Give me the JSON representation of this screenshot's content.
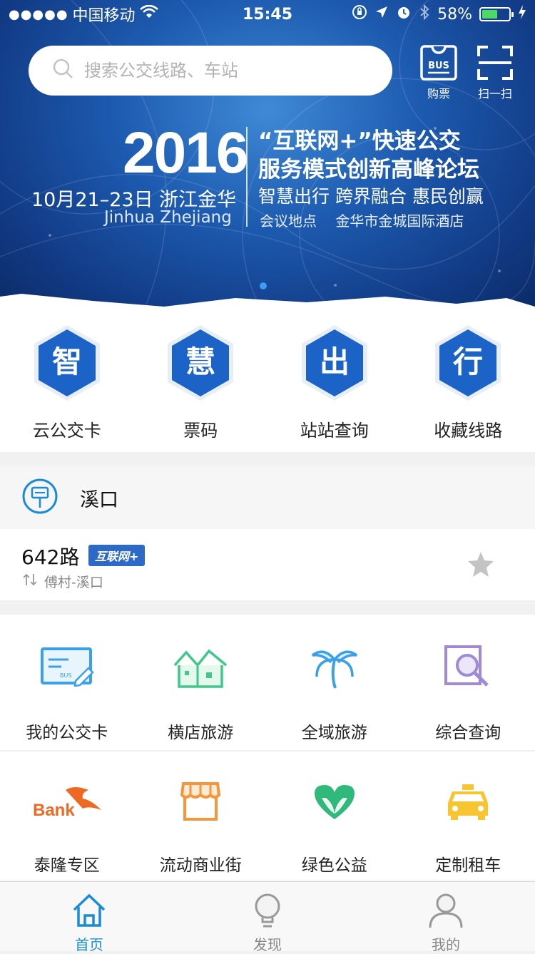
{
  "status_bar": {
    "signal": "●●●●●",
    "carrier": "中国移动",
    "time": "15:45",
    "battery_pct": "58%",
    "battery_level": 0.58
  },
  "search": {
    "placeholder": "搜索公交线路、车站"
  },
  "top_actions": [
    {
      "label": "购票",
      "icon": "bus-ticket-icon",
      "icon_text": "BUS"
    },
    {
      "label": "扫一扫",
      "icon": "scan-icon"
    }
  ],
  "banner": {
    "year": "2016",
    "date_place": "10月21–23日 浙江金华",
    "english": "Jinhua Zhejiang",
    "title_line1": "“互联网+”快速公交",
    "title_line2": "服务模式创新高峰论坛",
    "slogan": "智慧出行 跨界融合 惠民创赢",
    "venue": "会议地点 金华市金城国际酒店"
  },
  "quick_actions": [
    {
      "char": "智",
      "label": "云公交卡"
    },
    {
      "char": "慧",
      "label": "票码"
    },
    {
      "char": "出",
      "label": "站站查询"
    },
    {
      "char": "行",
      "label": "收藏线路"
    }
  ],
  "stop": {
    "name": "溪口",
    "route": {
      "number": "642路",
      "tag": "互联网+",
      "direction": "傅村-溪口"
    }
  },
  "services": [
    [
      {
        "label": "我的公交卡",
        "icon": "bus-card-icon",
        "icon_text": "BUS"
      },
      {
        "label": "横店旅游",
        "icon": "houses-icon"
      },
      {
        "label": "全域旅游",
        "icon": "palm-tree-icon"
      },
      {
        "label": "综合查询",
        "icon": "magnifier-document-icon"
      }
    ],
    [
      {
        "label": "泰隆专区",
        "icon": "bank-logo-icon",
        "icon_text": "Bank"
      },
      {
        "label": "流动商业街",
        "icon": "shop-icon"
      },
      {
        "label": "绿色公益",
        "icon": "green-heart-icon"
      },
      {
        "label": "定制租车",
        "icon": "taxi-icon"
      }
    ]
  ],
  "tabs": [
    {
      "label": "首页",
      "icon": "home-icon",
      "active": true
    },
    {
      "label": "发现",
      "icon": "lightbulb-icon",
      "active": false
    },
    {
      "label": "我的",
      "icon": "user-icon",
      "active": false
    }
  ],
  "colors": {
    "accent": "#1b8bd8",
    "banner_blue": "#1d5bb0",
    "tag_blue": "#2d6ac7",
    "battery_green": "#4cd964"
  }
}
